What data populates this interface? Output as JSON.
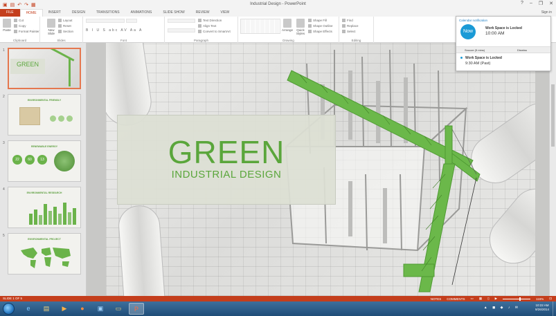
{
  "window": {
    "title": "Industrial Design - PowerPoint",
    "quick_access": [
      "save-icon",
      "undo-icon",
      "redo-icon",
      "start-from-beginning-icon"
    ],
    "controls": [
      "?",
      "–",
      "❐",
      "✕"
    ],
    "sign_in": "Sign in"
  },
  "ribbon": {
    "tabs": [
      "FILE",
      "HOME",
      "INSERT",
      "DESIGN",
      "TRANSITIONS",
      "ANIMATIONS",
      "SLIDE SHOW",
      "REVIEW",
      "VIEW"
    ],
    "active_tab": "HOME",
    "groups": {
      "clipboard": {
        "label": "Clipboard",
        "paste": "Paste",
        "cut": "Cut",
        "copy": "Copy",
        "format_painter": "Format Painter"
      },
      "slides": {
        "label": "Slides",
        "new_slide": "New Slide",
        "layout": "Layout",
        "reset": "Reset",
        "section": "Section"
      },
      "font": {
        "label": "Font",
        "icons": "B I U S abc AV Aa A"
      },
      "paragraph": {
        "label": "Paragraph",
        "text_direction": "Text Direction",
        "align_text": "Align Text",
        "convert_smartart": "Convert to SmartArt"
      },
      "drawing": {
        "label": "Drawing",
        "arrange": "Arrange",
        "quick_styles": "Quick Styles",
        "shape_fill": "Shape Fill",
        "shape_outline": "Shape Outline",
        "shape_effects": "Shape Effects"
      },
      "editing": {
        "label": "Editing",
        "find": "Find",
        "replace": "Replace",
        "select": "Select"
      }
    }
  },
  "notification": {
    "header": "Calendar notification",
    "now_label": "Now",
    "title": "Work Space is Locked",
    "time": "10:00 AM",
    "snooze_label": "Snooze (5 mins)",
    "dismiss_label": "Dismiss",
    "item_title": "Work Space is Locked",
    "item_time": "9:30 AM (Past)"
  },
  "slides_pane": {
    "slides": [
      {
        "num": "1",
        "title": "GREEN"
      },
      {
        "num": "2",
        "title": "ENVIRONMENTAL FRIENDLY"
      },
      {
        "num": "3",
        "title": "RENEWABLE ENERGY"
      },
      {
        "num": "4",
        "title": "ENVIRONMENTAL RESEARCH"
      },
      {
        "num": "5",
        "title": "ENVIRONMENTAL PROJECT"
      }
    ],
    "slide3_stats": [
      "22",
      "60",
      "13"
    ]
  },
  "slide": {
    "title": "GREEN",
    "subtitle": "INDUSTRIAL DESIGN",
    "accent_color": "#5aa63b"
  },
  "status_bar": {
    "slide_info": "SLIDE 1 OF 5",
    "notes": "NOTES",
    "comments": "COMMENTS",
    "zoom": "116%",
    "accent_color": "#c43e1c"
  },
  "taskbar": {
    "apps": [
      "internet-explorer-icon",
      "file-explorer-icon",
      "media-player-icon",
      "firefox-icon",
      "app-icon",
      "folder-icon",
      "powerpoint-icon"
    ],
    "time": "10:22 AM",
    "date": "9/26/2014"
  }
}
